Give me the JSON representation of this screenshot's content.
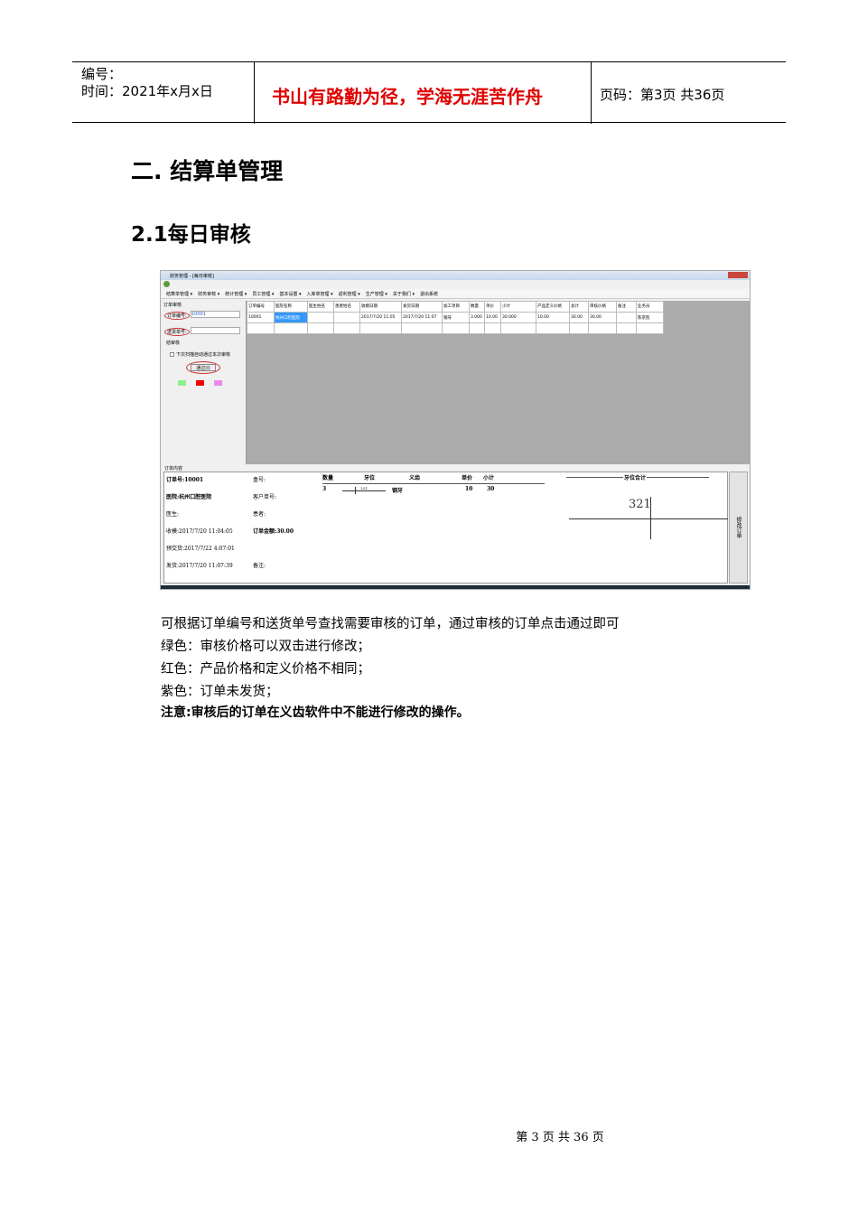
{
  "header": {
    "number_label": "编号：",
    "time_label": "时间：2021年x月x日",
    "motto": "书山有路勤为径，学海无涯苦作舟",
    "page_label": "页码：第3页  共36页"
  },
  "section_title": "二.  结算单管理",
  "subsection_title": "2.1每日审核",
  "screenshot": {
    "window_title": "财务管理 - [每日审核]",
    "menu": [
      "结算单管理 ▾",
      "财务审核 ▾",
      "统计管理 ▾",
      "员工管理 ▾",
      "基本设置 ▾",
      "入库单管理 ▾",
      "返利管理 ▾",
      "生产管理 ▾",
      "关于我们 ▾",
      "退出系统"
    ],
    "left": {
      "group": "订单审核",
      "order_no_label": "订单编号:",
      "order_no_value": "10001",
      "delivery_no_label": "送货单号:",
      "result_label": "结审核",
      "checkbox_label": "下次扫描自动通过本次审核",
      "pass_button": "通过(I)"
    },
    "colors": {
      "green": "#8cf28c",
      "red": "#ee0000",
      "purple": "#ee88ee"
    },
    "grid": {
      "headers": [
        "订单编号",
        "医院名称",
        "医生姓名",
        "患者姓名",
        "收模日期",
        "发货日期",
        "加工项目",
        "数量",
        "单价",
        "小计",
        "产品定义价格",
        "总计",
        "审核价格",
        "备注",
        "业务员"
      ],
      "rows": [
        [
          "10001",
          "杭州口腔医院",
          "",
          "",
          "2017/7/20 11:05",
          "2017/7/20 11:07",
          "钢牙",
          "3.000",
          "10.00",
          "30.000",
          "10.00",
          "30.00",
          "30.00",
          "",
          "陈宗凯"
        ]
      ]
    },
    "detail": {
      "panel_label": "订单内容",
      "order_no": "订单号:10001",
      "box_no": "盒号:",
      "hospital": "医院:杭州口腔医院",
      "customer_no": "客户单号:",
      "doctor": "医生:",
      "patient": "患者:",
      "received": "收模:2017/7/20 11:04:05",
      "amount": "订单金额:30.00",
      "pre_delivery": "预交货:2017/7/22 4:07:01",
      "delivered": "发货:2017/7/20 11:07:39",
      "remark": "备注:",
      "item_headers": [
        "数量",
        "牙位",
        "义齿",
        "单价",
        "小计"
      ],
      "item_row": [
        "3",
        "321",
        "钢牙",
        "10",
        "30"
      ],
      "tooth_total_label": "牙位合计",
      "tooth_total_value": "321",
      "edit_button": "修改订单"
    }
  },
  "paragraphs": [
    "可根据订单编号和送货单号查找需要审核的订单，通过审核的订单点击通过即可",
    "绿色：审核价格可以双击进行修改；",
    "红色：产品价格和定义价格不相同；",
    "紫色：订单未发货；",
    "注意:审核后的订单在义齿软件中不能进行修改的操作。"
  ],
  "footer": "第 3 页 共 36 页"
}
